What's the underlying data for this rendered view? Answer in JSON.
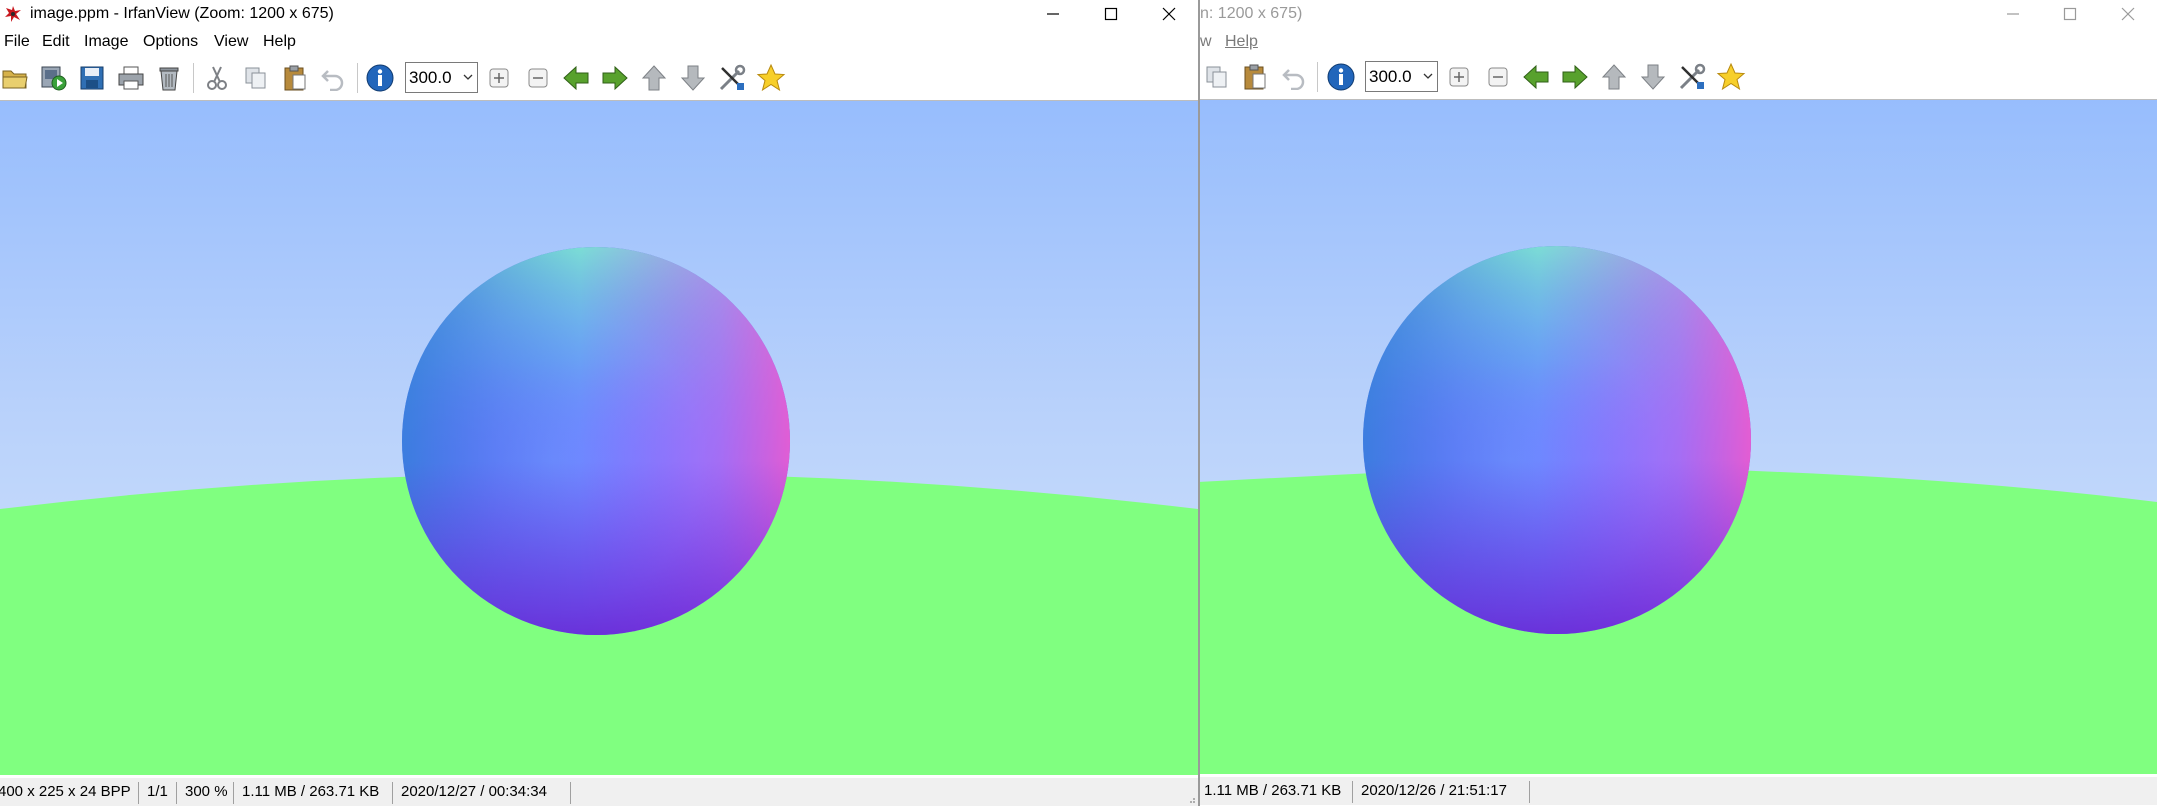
{
  "window1": {
    "title": "image.ppm - IrfanView (Zoom: 1200 x 675)",
    "menu": [
      "File",
      "Edit",
      "Image",
      "Options",
      "View",
      "Help"
    ],
    "zoom_value": "300.0",
    "status": {
      "dimensions": "400 x 225 x 24 BPP",
      "page": "1/1",
      "zoom": "300 %",
      "size": "1.11 MB / 263.71 KB",
      "datetime": "2020/12/27 / 00:34:34"
    }
  },
  "window2": {
    "title": "n: 1200 x 675)",
    "menu": [
      "w",
      "Help"
    ],
    "zoom_value": "300.0",
    "status": {
      "size": "1.11 MB / 263.71 KB",
      "datetime": "2020/12/26 / 21:51:17"
    }
  },
  "colors": {
    "sky_top": "#97bdfd",
    "sky_bottom": "#c8dcfb",
    "ground": "#80ff80",
    "sphere_light": "#7ae7d6",
    "sphere_mid": "#6c87ff",
    "sphere_dark": "#6b2ef0",
    "sphere_magenta": "#ee4fd8"
  },
  "icons": [
    "open-folder-icon",
    "slideshow-icon",
    "save-icon",
    "print-icon",
    "delete-icon",
    "cut-icon",
    "copy-icon",
    "paste-icon",
    "undo-icon",
    "info-icon",
    "zoom-in-icon",
    "zoom-out-icon",
    "previous-icon",
    "next-icon",
    "up-icon",
    "down-icon",
    "settings-icon",
    "favorite-icon"
  ]
}
